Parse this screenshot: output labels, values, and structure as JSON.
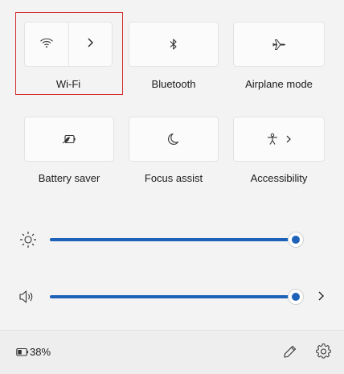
{
  "tiles": {
    "wifi": {
      "label": "Wi-Fi",
      "icon": "wifi-icon",
      "expand_icon": "chevron-right-icon"
    },
    "bluetooth": {
      "label": "Bluetooth",
      "icon": "bluetooth-icon"
    },
    "airplane": {
      "label": "Airplane mode",
      "icon": "airplane-icon"
    },
    "battery_saver": {
      "label": "Battery saver",
      "icon": "battery-saver-icon"
    },
    "focus_assist": {
      "label": "Focus assist",
      "icon": "moon-icon"
    },
    "accessibility": {
      "label": "Accessibility",
      "icon": "accessibility-icon",
      "expand_icon": "chevron-right-icon"
    }
  },
  "sliders": {
    "brightness": {
      "icon": "brightness-icon",
      "level_percent": 100
    },
    "volume": {
      "icon": "speaker-icon",
      "level_percent": 100,
      "expand_icon": "chevron-right-icon"
    }
  },
  "footer": {
    "battery_icon": "battery-icon",
    "battery_text": "38%",
    "edit_icon": "pencil-icon",
    "settings_icon": "gear-icon"
  },
  "colors": {
    "accent": "#1d62b8",
    "highlight_box": "#d32f2f"
  }
}
